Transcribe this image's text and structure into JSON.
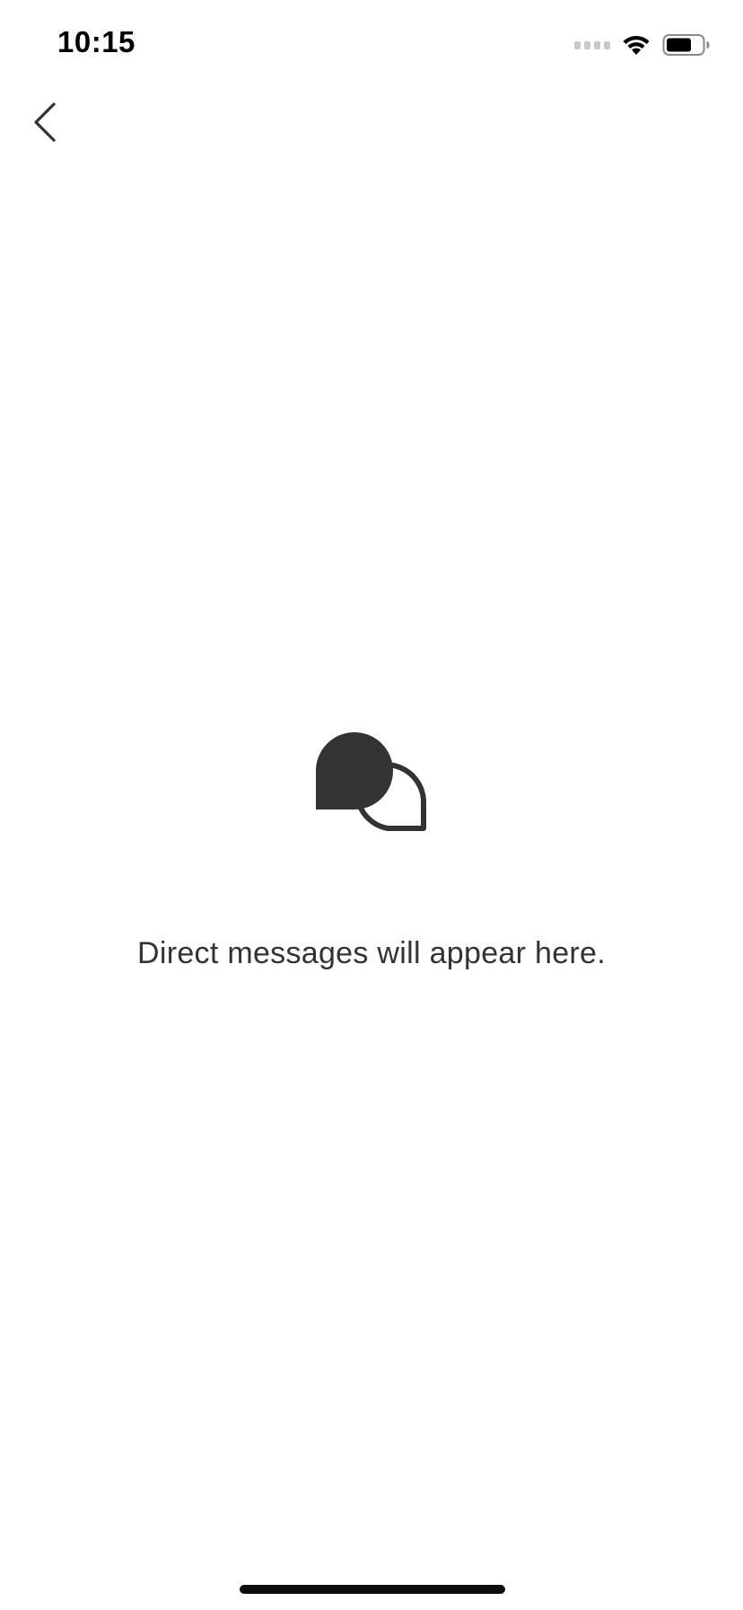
{
  "status_bar": {
    "time": "10:15",
    "icons": [
      "cellular-signal-icon",
      "wifi-icon",
      "battery-icon"
    ],
    "battery_level": 0.7
  },
  "nav": {
    "back_icon": "chevron-left-icon"
  },
  "empty_state": {
    "icon": "chat-bubbles-icon",
    "message": "Direct messages will appear here."
  },
  "colors": {
    "background": "#ffffff",
    "icon": "#333333",
    "text": "#333333",
    "status_text": "#000000"
  }
}
